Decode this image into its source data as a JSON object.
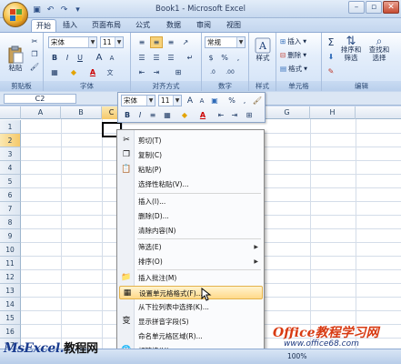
{
  "window": {
    "title": "Book1 - Microsoft Excel",
    "controls": [
      "–",
      "▫",
      "✕"
    ]
  },
  "qat": {
    "icons": [
      "save-icon",
      "undo-icon",
      "redo-icon",
      "customize-icon"
    ],
    "glyphs": [
      "▣",
      "↶",
      "↷",
      "▾"
    ]
  },
  "tabs": [
    "开始",
    "插入",
    "页面布局",
    "公式",
    "数据",
    "审阅",
    "视图"
  ],
  "ribbon": {
    "clipboard": {
      "paste": "粘贴",
      "label": "剪贴板"
    },
    "font": {
      "name": "宋体",
      "size": "11",
      "label": "字体",
      "bold": "B",
      "italic": "I",
      "underline": "U",
      "grow": "A",
      "shrink": "A"
    },
    "alignment": {
      "label": "对齐方式"
    },
    "number": {
      "format": "常规",
      "label": "数字",
      "currency": "$",
      "percent": "%",
      "comma": ",",
      "dec_inc": ".0",
      "dec_dec": ".00"
    },
    "styles": {
      "label": "样式"
    },
    "cells": {
      "insert": "插入",
      "delete": "删除",
      "format": "格式",
      "label": "单元格"
    },
    "editing": {
      "sigma": "Σ",
      "sort": "排序和\n筛选",
      "find": "查找和\n选择",
      "label": "编辑"
    }
  },
  "formula_bar": {
    "name_box": "C2"
  },
  "columns": [
    "A",
    "B",
    "C",
    "D",
    "E",
    "F",
    "G",
    "H"
  ],
  "rows": [
    "1",
    "2",
    "3",
    "4",
    "5",
    "6",
    "7",
    "8",
    "9",
    "10",
    "11",
    "12",
    "13",
    "14",
    "15",
    "16",
    "17"
  ],
  "mini_toolbar": {
    "font": "宋体",
    "size": "11",
    "a_big": "A",
    "a_small": "A",
    "percent": "%",
    "comma": ",",
    "bold": "B",
    "italic": "I",
    "font_color": "A",
    "align": "≡"
  },
  "context_menu": {
    "items": [
      {
        "label": "剪切(T)",
        "icon": "cut-icon",
        "glyph": "✂"
      },
      {
        "label": "复制(C)",
        "icon": "copy-icon",
        "glyph": "❐"
      },
      {
        "label": "粘贴(P)",
        "icon": "paste-icon",
        "glyph": "📋"
      },
      {
        "label": "选择性粘贴(V)...",
        "icon": "",
        "glyph": ""
      },
      {
        "label": "插入(I)...",
        "icon": "",
        "glyph": ""
      },
      {
        "label": "删除(D)...",
        "icon": "",
        "glyph": ""
      },
      {
        "label": "清除内容(N)",
        "icon": "",
        "glyph": ""
      },
      {
        "label": "筛选(E)",
        "icon": "",
        "glyph": "",
        "submenu": "▶"
      },
      {
        "label": "排序(O)",
        "icon": "",
        "glyph": "",
        "submenu": "▶"
      },
      {
        "label": "插入批注(M)",
        "icon": "comment-icon",
        "glyph": "📁"
      },
      {
        "label": "设置单元格格式(F)...",
        "icon": "format-cells-icon",
        "glyph": "▦"
      },
      {
        "label": "从下拉列表中选择(K)...",
        "icon": "",
        "glyph": ""
      },
      {
        "label": "显示拼音字段(S)",
        "icon": "phonetic-icon",
        "glyph": "变"
      },
      {
        "label": "命名单元格区域(R)...",
        "icon": "",
        "glyph": ""
      },
      {
        "label": "超链接(H)...",
        "icon": "hyperlink-icon",
        "glyph": "🌐"
      }
    ]
  },
  "watermarks": {
    "left_brand": "MsExcel.",
    "left_cn": "教程网",
    "right_brand": "Office教程学习网",
    "right_url": "www.office68.com"
  },
  "status": {
    "zoom": "100%"
  }
}
